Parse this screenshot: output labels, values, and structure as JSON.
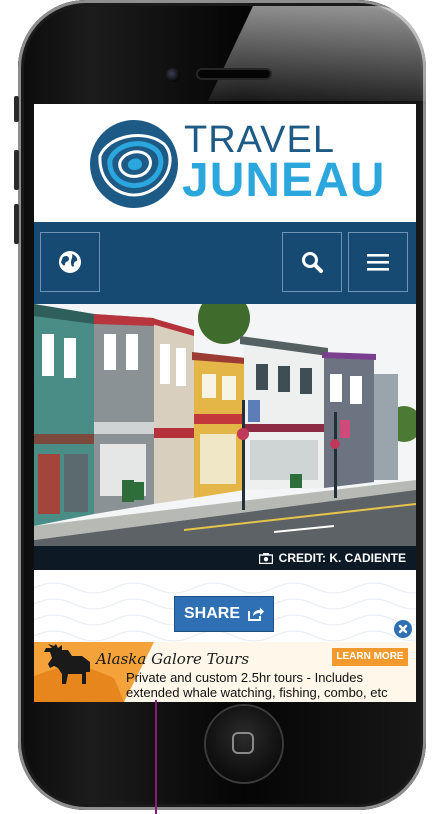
{
  "site": {
    "logo_line1": "TRAVEL",
    "logo_line2": "JUNEAU"
  },
  "nav": {
    "globe_icon": "globe-icon",
    "search_icon": "search-icon",
    "menu_icon": "hamburger-menu-icon"
  },
  "hero": {
    "credit_text": "CREDIT: K. CADIENTE",
    "camera_icon": "camera-icon"
  },
  "share": {
    "label": "SHARE",
    "icon": "share-arrow-icon"
  },
  "ad": {
    "title": "Alaska Galore Tours",
    "learn_more": "LEARN MORE",
    "text": "Private and custom 2.5hr tours - Includes extended whale watching, fishing, combo, etc",
    "close_icon": "close-icon"
  },
  "colors": {
    "brand_dark": "#174a72",
    "brand_light": "#2ba7de",
    "share_blue": "#2f6fb3",
    "ad_orange": "#f29a2e"
  }
}
